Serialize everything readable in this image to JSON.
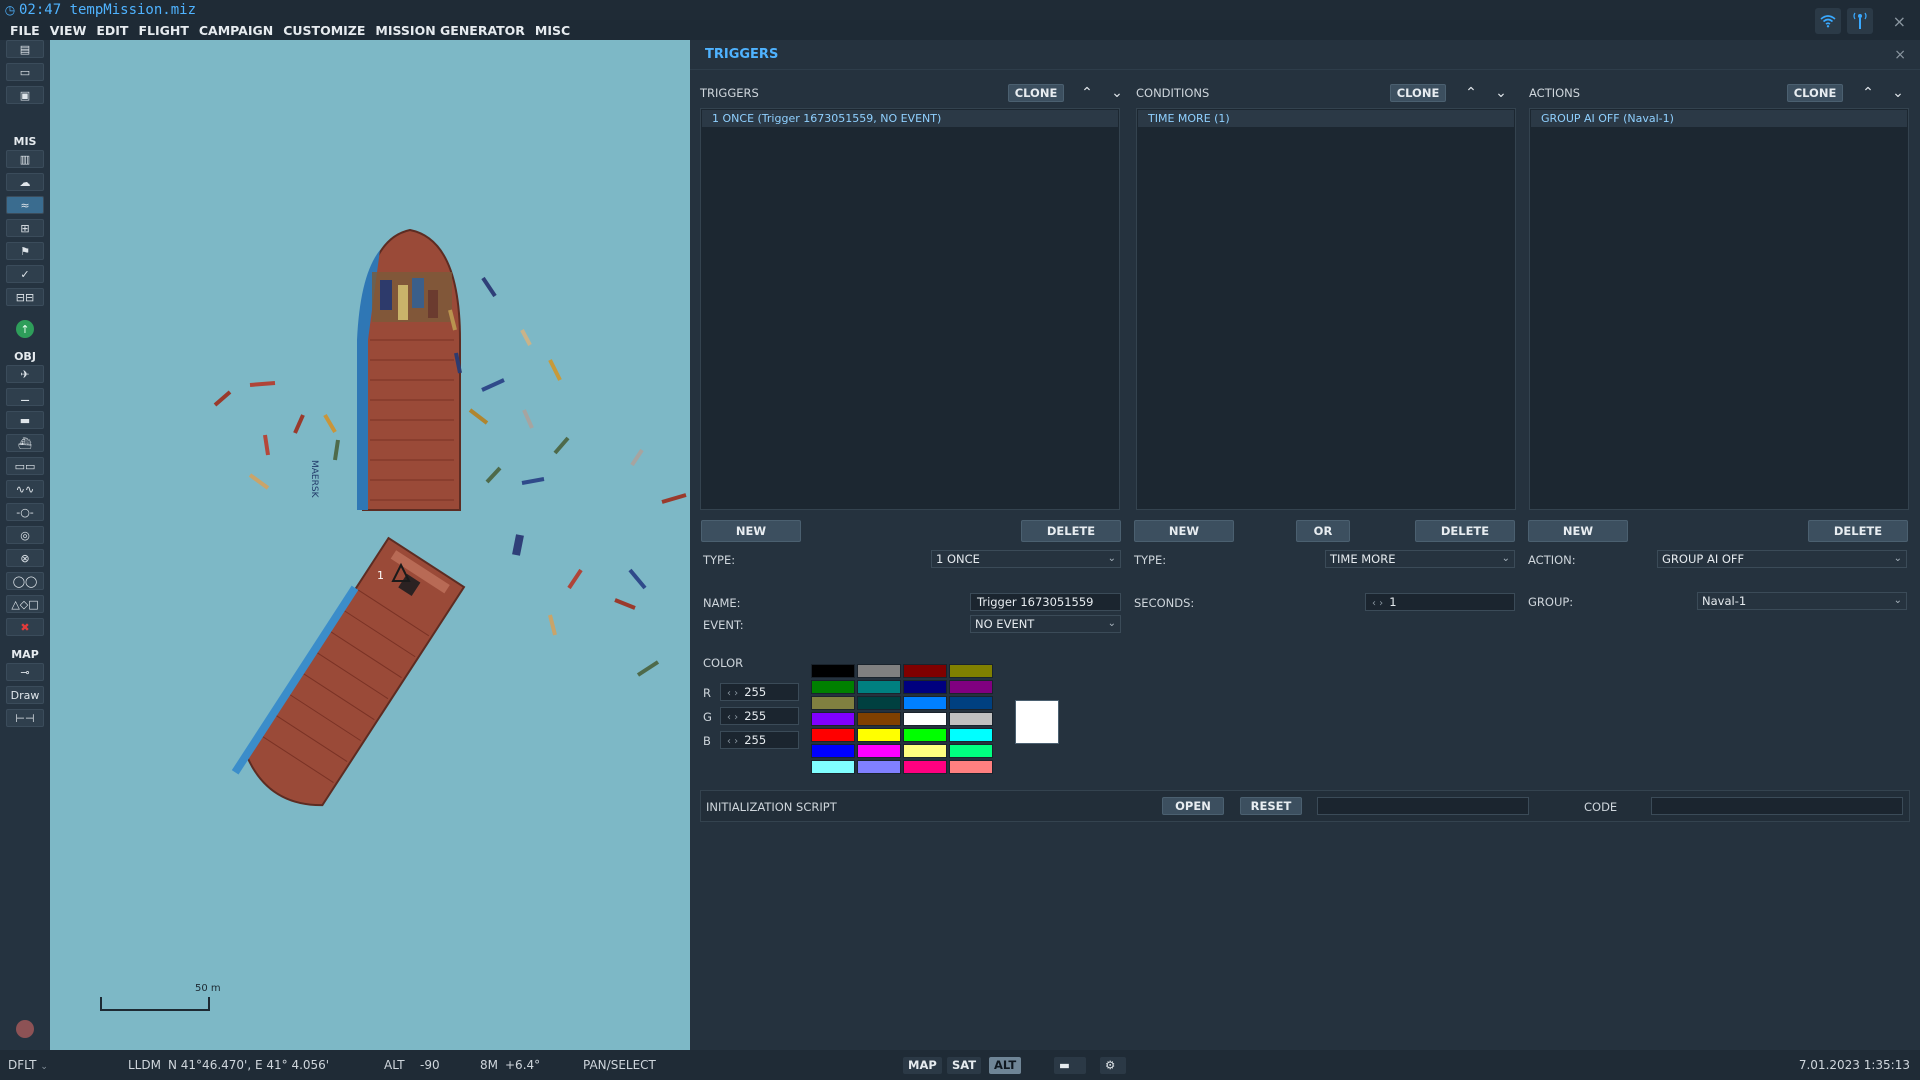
{
  "window": {
    "title": "02:47 tempMission.miz",
    "clock_icon": "clock-icon",
    "wifi_icon": "wifi-icon",
    "antenna_icon": "antenna-icon",
    "close_glyph": "×"
  },
  "menu": [
    "FILE",
    "VIEW",
    "EDIT",
    "FLIGHT",
    "CAMPAIGN",
    "CUSTOMIZE",
    "MISSION GENERATOR",
    "MISC"
  ],
  "toolbar": {
    "mis_label": "MIS",
    "obj_label": "OBJ",
    "map_label": "MAP",
    "draw_label": "Draw"
  },
  "map": {
    "scale_label": "50 m",
    "unit_marker": "1",
    "ship_hull_text": "MAERSK",
    "water_color": "#7db8c6"
  },
  "panel": {
    "title": "TRIGGERS",
    "close_glyph": "×",
    "triggers": {
      "header": "TRIGGERS",
      "clone": "CLONE",
      "items": [
        "1 ONCE (Trigger 1673051559, NO EVENT)"
      ],
      "new": "NEW",
      "delete": "DELETE",
      "type_label": "TYPE:",
      "type_value": "1 ONCE",
      "name_label": "NAME:",
      "name_value": "Trigger 1673051559",
      "event_label": "EVENT:",
      "event_value": "NO EVENT"
    },
    "conditions": {
      "header": "CONDITIONS",
      "clone": "CLONE",
      "items": [
        "TIME MORE (1)"
      ],
      "new": "NEW",
      "or": "OR",
      "delete": "DELETE",
      "type_label": "TYPE:",
      "type_value": "TIME MORE",
      "seconds_label": "SECONDS:",
      "seconds_value": "1"
    },
    "actions": {
      "header": "ACTIONS",
      "clone": "CLONE",
      "items": [
        "GROUP AI OFF (Naval-1)"
      ],
      "new": "NEW",
      "delete": "DELETE",
      "action_label": "ACTION:",
      "action_value": "GROUP AI OFF",
      "group_label": "GROUP:",
      "group_value": "Naval-1"
    },
    "color": {
      "label": "COLOR",
      "r_label": "R",
      "r_value": "255",
      "g_label": "G",
      "g_value": "255",
      "b_label": "B",
      "b_value": "255",
      "preview": "#ffffff",
      "palette": [
        "#000000",
        "#808080",
        "#7f0000",
        "#808000",
        "#008000",
        "#008080",
        "#00007f",
        "#800080",
        "#808040",
        "#004040",
        "#0080ff",
        "#004080",
        "#8000ff",
        "#804000",
        "#ffffff",
        "#c0c0c0",
        "#ff0000",
        "#ffff00",
        "#00ff00",
        "#00ffff",
        "#0000ff",
        "#ff00ff",
        "#ffff80",
        "#00ff80",
        "#80ffff",
        "#8080ff",
        "#ff0080",
        "#ff8080"
      ]
    },
    "init_script": {
      "label": "INITIALIZATION SCRIPT",
      "open": "OPEN",
      "reset": "RESET",
      "code_label": "CODE"
    }
  },
  "status": {
    "profile": "DFLT",
    "coord_system": "LLDM",
    "coords": "N 41°46.470', E 41° 4.056'",
    "alt_label": "ALT",
    "alt_value": "-90",
    "magvar": "8M",
    "magvar_value": "+6.4°",
    "mode": "PAN/SELECT",
    "btn_map": "MAP",
    "btn_sat": "SAT",
    "btn_alt": "ALT",
    "datetime": "7.01.2023 1:35:13"
  }
}
